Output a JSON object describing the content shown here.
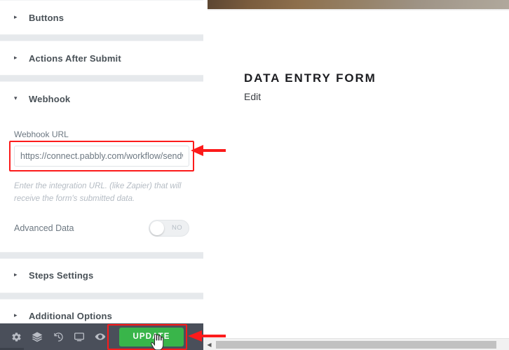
{
  "panel": {
    "sections": [
      {
        "id": "buttons",
        "label": "Buttons",
        "caret": "▸",
        "expanded": false
      },
      {
        "id": "actions-after-submit",
        "label": "Actions After Submit",
        "caret": "▸",
        "expanded": false
      },
      {
        "id": "webhook",
        "label": "Webhook",
        "caret": "▾",
        "expanded": true
      },
      {
        "id": "steps-settings",
        "label": "Steps Settings",
        "caret": "▸",
        "expanded": false
      },
      {
        "id": "additional-options",
        "label": "Additional Options",
        "caret": "▸",
        "expanded": false
      }
    ],
    "webhook": {
      "url_label": "Webhook URL",
      "url_value": "https://connect.pabbly.com/workflow/sendw",
      "url_placeholder": "https://",
      "help_text": "Enter the integration URL. (like Zapier) that will receive the form's submitted data.",
      "advanced_data_label": "Advanced Data",
      "advanced_data_state": "NO"
    },
    "footer": {
      "icons": [
        {
          "name": "gear-icon",
          "title": "Settings"
        },
        {
          "name": "layers-icon",
          "title": "Navigator"
        },
        {
          "name": "history-icon",
          "title": "History"
        },
        {
          "name": "responsive-mode-icon",
          "title": "Responsive Mode"
        },
        {
          "name": "eye-icon",
          "title": "Preview Changes"
        }
      ],
      "update_label": "UPDATE"
    }
  },
  "divider": {
    "collapse_icon": "‹"
  },
  "canvas": {
    "form_title": "DATA ENTRY FORM",
    "edit_link": "Edit"
  },
  "scrollbar": {
    "left_arrow": "◀"
  },
  "colors": {
    "accent_green": "#39b54a",
    "annotation_red": "#fc1b1b",
    "panel_bg": "#e6e9ec",
    "footer_bg": "#4a4f5a"
  }
}
